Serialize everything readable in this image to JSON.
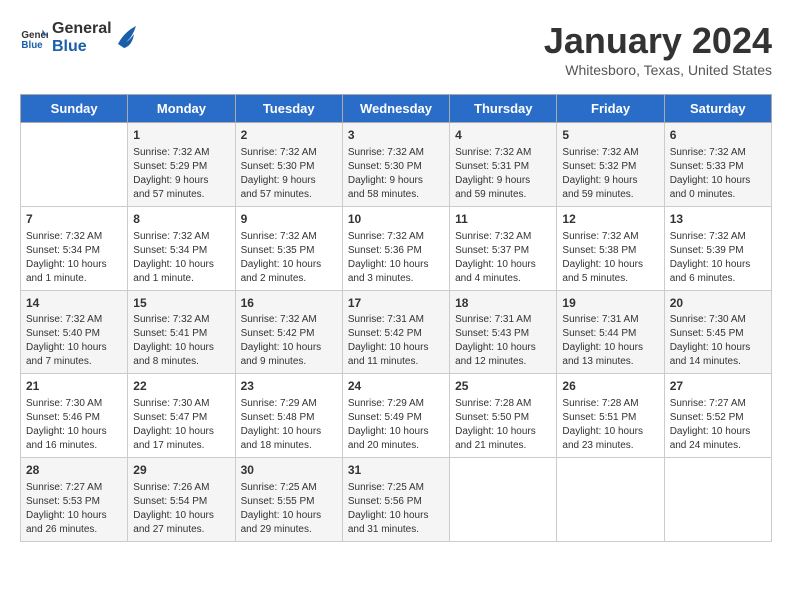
{
  "header": {
    "logo_line1": "General",
    "logo_line2": "Blue",
    "month": "January 2024",
    "location": "Whitesboro, Texas, United States"
  },
  "days_of_week": [
    "Sunday",
    "Monday",
    "Tuesday",
    "Wednesday",
    "Thursday",
    "Friday",
    "Saturday"
  ],
  "weeks": [
    [
      {
        "day": "",
        "info": ""
      },
      {
        "day": "1",
        "info": "Sunrise: 7:32 AM\nSunset: 5:29 PM\nDaylight: 9 hours\nand 57 minutes."
      },
      {
        "day": "2",
        "info": "Sunrise: 7:32 AM\nSunset: 5:30 PM\nDaylight: 9 hours\nand 57 minutes."
      },
      {
        "day": "3",
        "info": "Sunrise: 7:32 AM\nSunset: 5:30 PM\nDaylight: 9 hours\nand 58 minutes."
      },
      {
        "day": "4",
        "info": "Sunrise: 7:32 AM\nSunset: 5:31 PM\nDaylight: 9 hours\nand 59 minutes."
      },
      {
        "day": "5",
        "info": "Sunrise: 7:32 AM\nSunset: 5:32 PM\nDaylight: 9 hours\nand 59 minutes."
      },
      {
        "day": "6",
        "info": "Sunrise: 7:32 AM\nSunset: 5:33 PM\nDaylight: 10 hours\nand 0 minutes."
      }
    ],
    [
      {
        "day": "7",
        "info": "Sunrise: 7:32 AM\nSunset: 5:34 PM\nDaylight: 10 hours\nand 1 minute."
      },
      {
        "day": "8",
        "info": "Sunrise: 7:32 AM\nSunset: 5:34 PM\nDaylight: 10 hours\nand 1 minute."
      },
      {
        "day": "9",
        "info": "Sunrise: 7:32 AM\nSunset: 5:35 PM\nDaylight: 10 hours\nand 2 minutes."
      },
      {
        "day": "10",
        "info": "Sunrise: 7:32 AM\nSunset: 5:36 PM\nDaylight: 10 hours\nand 3 minutes."
      },
      {
        "day": "11",
        "info": "Sunrise: 7:32 AM\nSunset: 5:37 PM\nDaylight: 10 hours\nand 4 minutes."
      },
      {
        "day": "12",
        "info": "Sunrise: 7:32 AM\nSunset: 5:38 PM\nDaylight: 10 hours\nand 5 minutes."
      },
      {
        "day": "13",
        "info": "Sunrise: 7:32 AM\nSunset: 5:39 PM\nDaylight: 10 hours\nand 6 minutes."
      }
    ],
    [
      {
        "day": "14",
        "info": "Sunrise: 7:32 AM\nSunset: 5:40 PM\nDaylight: 10 hours\nand 7 minutes."
      },
      {
        "day": "15",
        "info": "Sunrise: 7:32 AM\nSunset: 5:41 PM\nDaylight: 10 hours\nand 8 minutes."
      },
      {
        "day": "16",
        "info": "Sunrise: 7:32 AM\nSunset: 5:42 PM\nDaylight: 10 hours\nand 9 minutes."
      },
      {
        "day": "17",
        "info": "Sunrise: 7:31 AM\nSunset: 5:42 PM\nDaylight: 10 hours\nand 11 minutes."
      },
      {
        "day": "18",
        "info": "Sunrise: 7:31 AM\nSunset: 5:43 PM\nDaylight: 10 hours\nand 12 minutes."
      },
      {
        "day": "19",
        "info": "Sunrise: 7:31 AM\nSunset: 5:44 PM\nDaylight: 10 hours\nand 13 minutes."
      },
      {
        "day": "20",
        "info": "Sunrise: 7:30 AM\nSunset: 5:45 PM\nDaylight: 10 hours\nand 14 minutes."
      }
    ],
    [
      {
        "day": "21",
        "info": "Sunrise: 7:30 AM\nSunset: 5:46 PM\nDaylight: 10 hours\nand 16 minutes."
      },
      {
        "day": "22",
        "info": "Sunrise: 7:30 AM\nSunset: 5:47 PM\nDaylight: 10 hours\nand 17 minutes."
      },
      {
        "day": "23",
        "info": "Sunrise: 7:29 AM\nSunset: 5:48 PM\nDaylight: 10 hours\nand 18 minutes."
      },
      {
        "day": "24",
        "info": "Sunrise: 7:29 AM\nSunset: 5:49 PM\nDaylight: 10 hours\nand 20 minutes."
      },
      {
        "day": "25",
        "info": "Sunrise: 7:28 AM\nSunset: 5:50 PM\nDaylight: 10 hours\nand 21 minutes."
      },
      {
        "day": "26",
        "info": "Sunrise: 7:28 AM\nSunset: 5:51 PM\nDaylight: 10 hours\nand 23 minutes."
      },
      {
        "day": "27",
        "info": "Sunrise: 7:27 AM\nSunset: 5:52 PM\nDaylight: 10 hours\nand 24 minutes."
      }
    ],
    [
      {
        "day": "28",
        "info": "Sunrise: 7:27 AM\nSunset: 5:53 PM\nDaylight: 10 hours\nand 26 minutes."
      },
      {
        "day": "29",
        "info": "Sunrise: 7:26 AM\nSunset: 5:54 PM\nDaylight: 10 hours\nand 27 minutes."
      },
      {
        "day": "30",
        "info": "Sunrise: 7:25 AM\nSunset: 5:55 PM\nDaylight: 10 hours\nand 29 minutes."
      },
      {
        "day": "31",
        "info": "Sunrise: 7:25 AM\nSunset: 5:56 PM\nDaylight: 10 hours\nand 31 minutes."
      },
      {
        "day": "",
        "info": ""
      },
      {
        "day": "",
        "info": ""
      },
      {
        "day": "",
        "info": ""
      }
    ]
  ]
}
